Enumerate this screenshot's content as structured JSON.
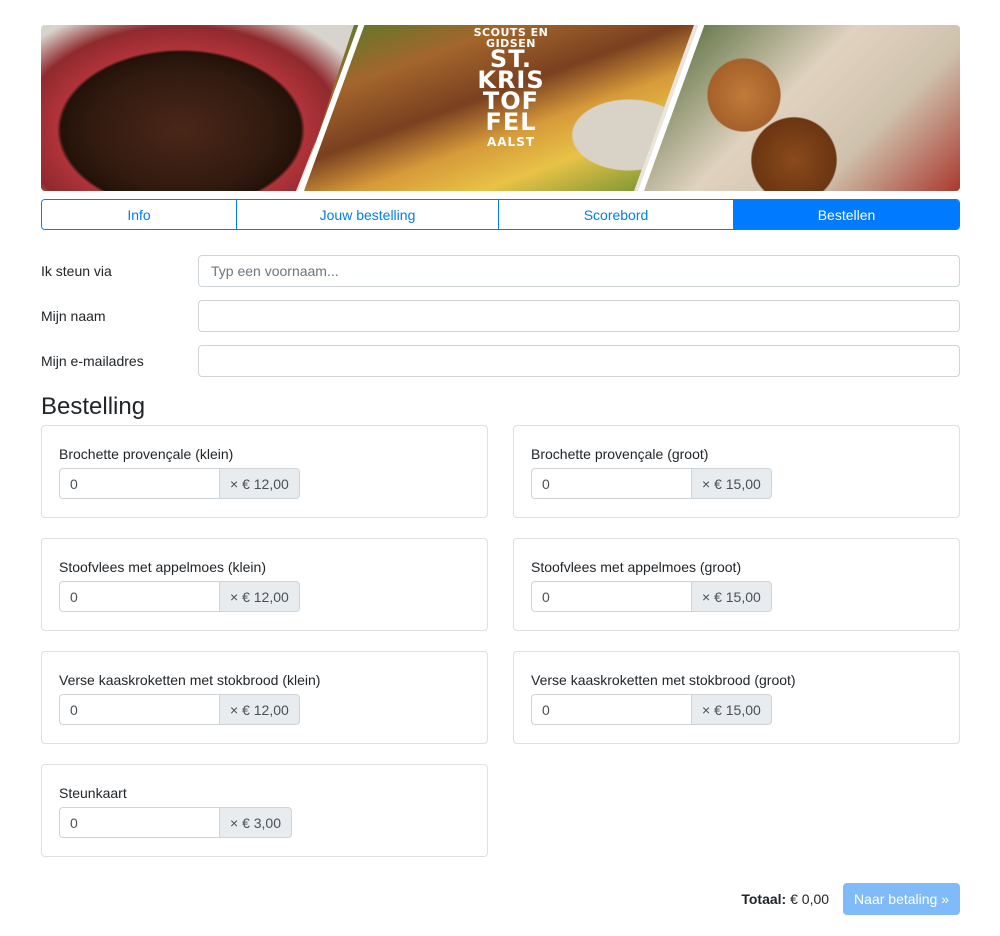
{
  "banner": {
    "brand_top": "SCOUTS EN GIDSEN",
    "brand_lines": [
      "ST.",
      "KRIS",
      "TOF",
      "FEL"
    ],
    "brand_bottom": "AALST",
    "images": [
      "stoofvlees-photo",
      "brochette-fries-photo",
      "kaaskroketten-photo"
    ]
  },
  "nav": {
    "tabs": [
      {
        "label": "Info",
        "active": false
      },
      {
        "label": "Jouw bestelling",
        "active": false
      },
      {
        "label": "Scorebord",
        "active": false
      },
      {
        "label": "Bestellen",
        "active": true
      }
    ]
  },
  "form": {
    "support": {
      "label": "Ik steun via",
      "value": "",
      "placeholder": "Typ een voornaam..."
    },
    "name": {
      "label": "Mijn naam",
      "value": "",
      "placeholder": ""
    },
    "email": {
      "label": "Mijn e-mailadres",
      "value": "",
      "placeholder": ""
    }
  },
  "order": {
    "heading": "Bestelling",
    "products": [
      {
        "name": "Brochette provençale (klein)",
        "quantity": "0",
        "price": "× € 12,00"
      },
      {
        "name": "Brochette provençale (groot)",
        "quantity": "0",
        "price": "× € 15,00"
      },
      {
        "name": "Stoofvlees met appelmoes (klein)",
        "quantity": "0",
        "price": "× € 12,00"
      },
      {
        "name": "Stoofvlees met appelmoes (groot)",
        "quantity": "0",
        "price": "× € 15,00"
      },
      {
        "name": "Verse kaaskroketten met stokbrood (klein)",
        "quantity": "0",
        "price": "× € 12,00"
      },
      {
        "name": "Verse kaaskroketten met stokbrood (groot)",
        "quantity": "0",
        "price": "× € 15,00"
      },
      {
        "name": "Steunkaart",
        "quantity": "0",
        "price": "× € 3,00"
      }
    ]
  },
  "footer": {
    "total_label": "Totaal:",
    "total_value": "€ 0,00",
    "pay_button": "Naar betaling »"
  },
  "colors": {
    "primary": "#007bff",
    "button_disabled": "#7fbaf9"
  }
}
